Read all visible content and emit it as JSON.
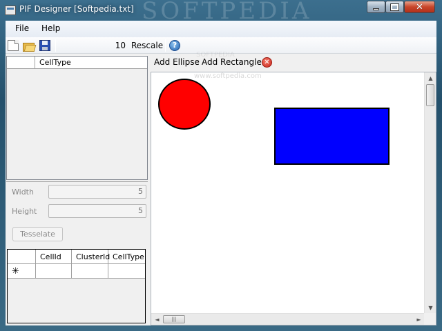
{
  "window": {
    "title": "PIF Designer [Softpedia.txt]",
    "watermark": "SOFTPEDIA",
    "min_glyph": "",
    "max_glyph": "",
    "close_glyph": "✕"
  },
  "menu": {
    "file": "File",
    "help": "Help"
  },
  "toolbar": {
    "value": "10",
    "rescale_label": "Rescale",
    "help_glyph": "?"
  },
  "top_grid": {
    "column": "CellType"
  },
  "fields": {
    "width_label": "Width",
    "width_value": "5",
    "height_label": "Height",
    "height_value": "5"
  },
  "tesselate_label": "Tesselate",
  "bottom_grid": {
    "columns": [
      "CellId",
      "ClusterId",
      "CellType"
    ],
    "new_row_marker": "✳"
  },
  "shape_toolbar": {
    "add_ellipse": "Add Ellipse",
    "add_rectangle": "Add Rectangle",
    "watermark": "SOFTPEDIA",
    "delete_glyph": "✕"
  },
  "canvas": {
    "watermark": "www.softpedia.com",
    "ellipse_color": "#ff0000",
    "rect_color": "#0000ff"
  },
  "scrollbars": {
    "up": "▲",
    "down": "▼",
    "left": "◄",
    "right": "►",
    "grip": "|||"
  }
}
